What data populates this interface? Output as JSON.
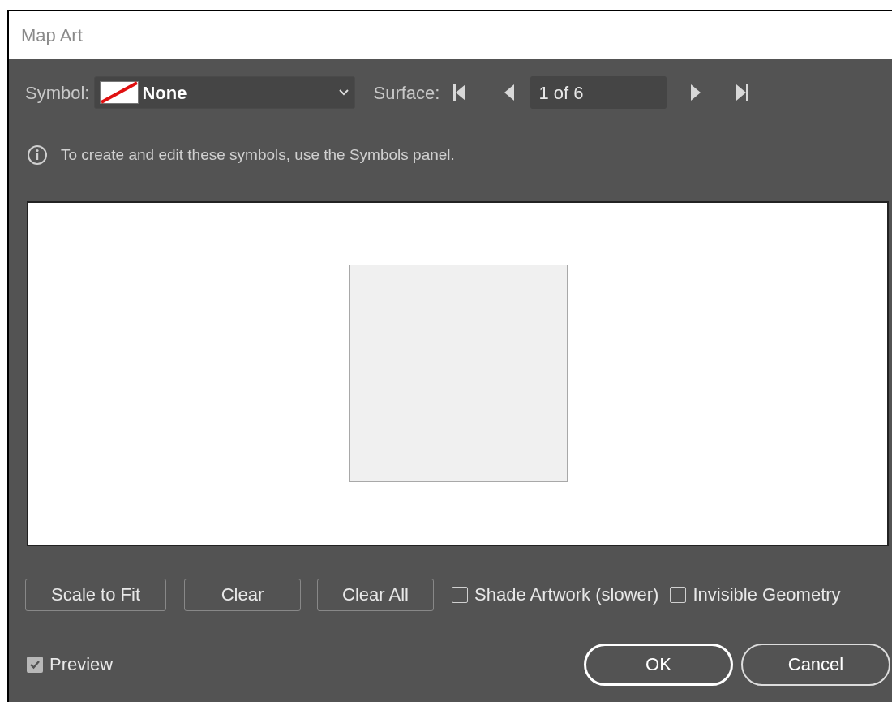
{
  "window": {
    "title": "Map Art"
  },
  "symbol": {
    "label": "Symbol:",
    "value": "None"
  },
  "surface": {
    "label": "Surface:",
    "value": "1 of 6"
  },
  "info": "To create and edit these symbols, use the Symbols panel.",
  "buttons": [
    "Scale to Fit",
    "Clear",
    "Clear All"
  ],
  "options": [
    {
      "label": "Shade Artwork (slower)",
      "checked": false
    },
    {
      "label": "Invisible Geometry",
      "checked": false
    }
  ],
  "preview": {
    "label": "Preview",
    "checked": true
  },
  "actions": [
    {
      "label": "OK",
      "kind": "default"
    },
    {
      "label": "Cancel",
      "kind": "normal"
    }
  ]
}
